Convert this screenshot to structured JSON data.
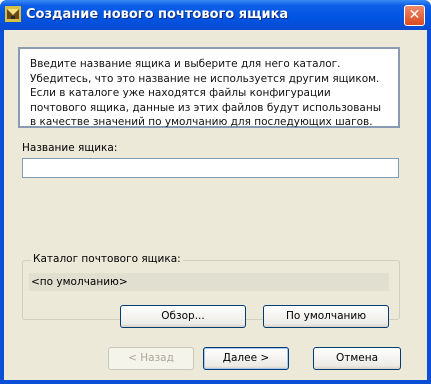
{
  "window": {
    "title": "Создание нового почтового ящика",
    "close_glyph": "✕",
    "icon": "mailbox-wizard-icon"
  },
  "intro": {
    "text": "Введите название ящика и выберите для него каталог. Убедитесь, что это название не используется другим ящиком. Если в каталоге уже находятся файлы конфигурации почтового ящика, данные из этих файлов будут использованы в качестве значений по умолчанию для последующих шагов."
  },
  "name_field": {
    "label": "Название ящика:",
    "value": ""
  },
  "catalog": {
    "title": "Каталог почтового ящика:",
    "value": "<по умолчанию>"
  },
  "buttons": {
    "browse": "Обзор...",
    "default": "По умолчанию",
    "back": "< Назад",
    "next": "Далее >",
    "cancel": "Отмена"
  }
}
